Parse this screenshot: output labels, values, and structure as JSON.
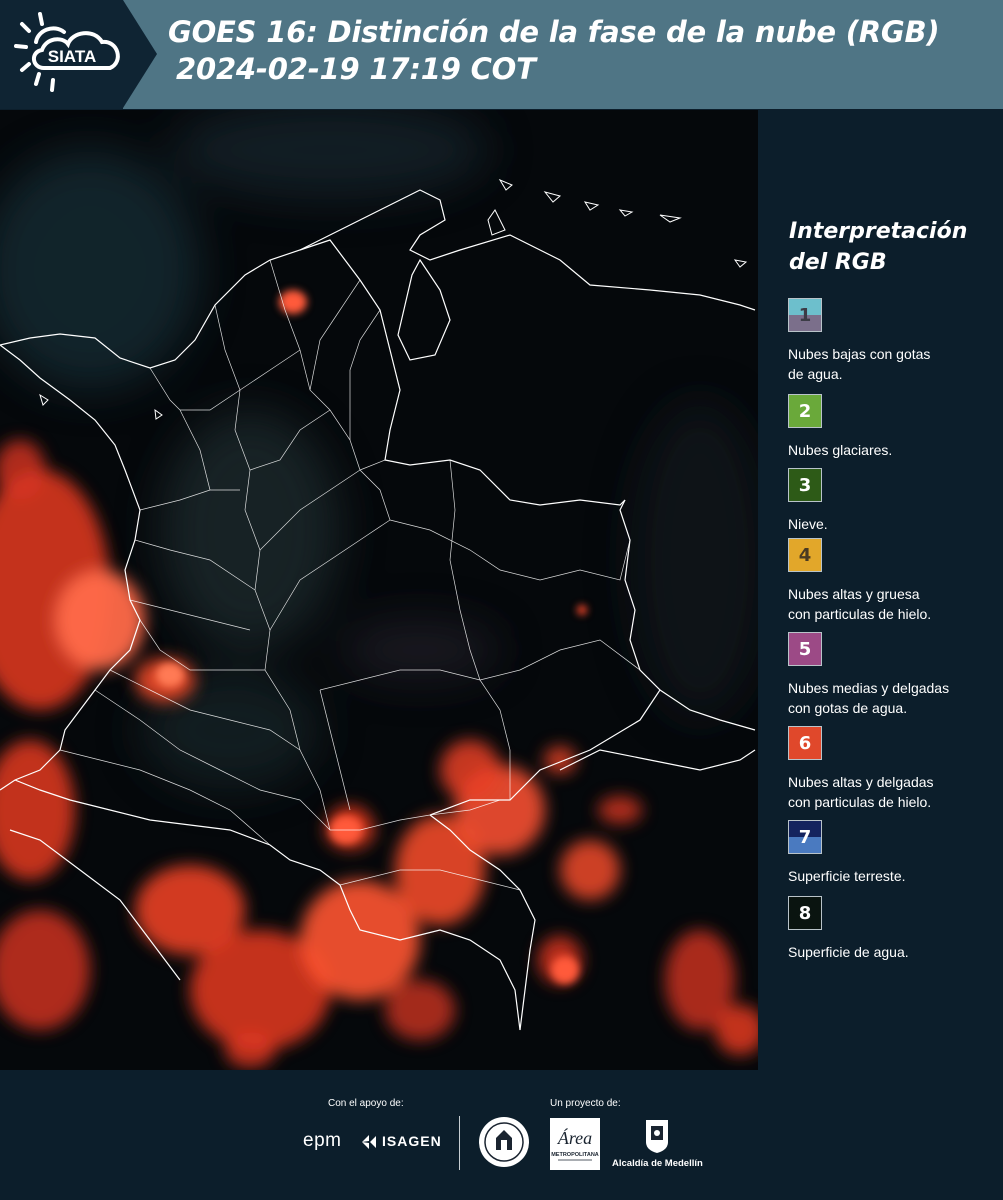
{
  "header": {
    "logo_text": "SIATA",
    "title_line1": "GOES 16: Distinción de la fase de la nube (RGB)",
    "title_line2": "2024-02-19 17:19 COT"
  },
  "legend": {
    "title_line1": "Interpretación",
    "title_line2": "del RGB",
    "items": [
      {
        "number": "1",
        "label_line1": "Nubes bajas con gotas",
        "label_line2": "de agua.",
        "color_top": "#6dbfcc",
        "color_bottom": "#7b6f8b",
        "num_color": "#3c3c46"
      },
      {
        "number": "2",
        "label_line1": "Nubes glaciares.",
        "label_line2": "",
        "color_top": "#6aa93a",
        "color_bottom": "#6aa93a",
        "num_color": "#ffffff"
      },
      {
        "number": "3",
        "label_line1": "Nieve.",
        "label_line2": "",
        "color_top": "#2d5a17",
        "color_bottom": "#2d5a17",
        "num_color": "#ffffff"
      },
      {
        "number": "4",
        "label_line1": "Nubes altas y gruesa",
        "label_line2": "con particulas de hielo.",
        "color_top": "#e2a72a",
        "color_bottom": "#e2a72a",
        "num_color": "#4a3a22"
      },
      {
        "number": "5",
        "label_line1": "Nubes medias y delgadas",
        "label_line2": "con gotas de agua.",
        "color_top": "#9c4a86",
        "color_bottom": "#9c4a86",
        "num_color": "#ffffff"
      },
      {
        "number": "6",
        "label_line1": "Nubes altas y delgadas",
        "label_line2": "con particulas de hielo.",
        "color_top": "#e0482b",
        "color_bottom": "#e0482b",
        "num_color": "#ffffff"
      },
      {
        "number": "7",
        "label_line1": "Superficie terreste.",
        "label_line2": "",
        "color_top": "#14235e",
        "color_bottom": "#4a7ac0",
        "num_color": "#ffffff"
      },
      {
        "number": "8",
        "label_line1": "Superficie de agua.",
        "label_line2": "",
        "color_top": "#0a1410",
        "color_bottom": "#0a1410",
        "num_color": "#ffffff"
      }
    ]
  },
  "footer": {
    "support_label": "Con el apoyo de:",
    "project_label": "Un proyecto de:",
    "epm_text": "epm",
    "isagen_text": "ISAGEN",
    "area_text": "Área",
    "area_subtext": "METROPOLITANA",
    "medellin_text": "Alcaldía de Medellín"
  },
  "colors": {
    "header_bg": "#0f2433",
    "banner": "#4f7585",
    "panel_bg": "#0c1e2b",
    "cloud_red": "#e63a22"
  }
}
